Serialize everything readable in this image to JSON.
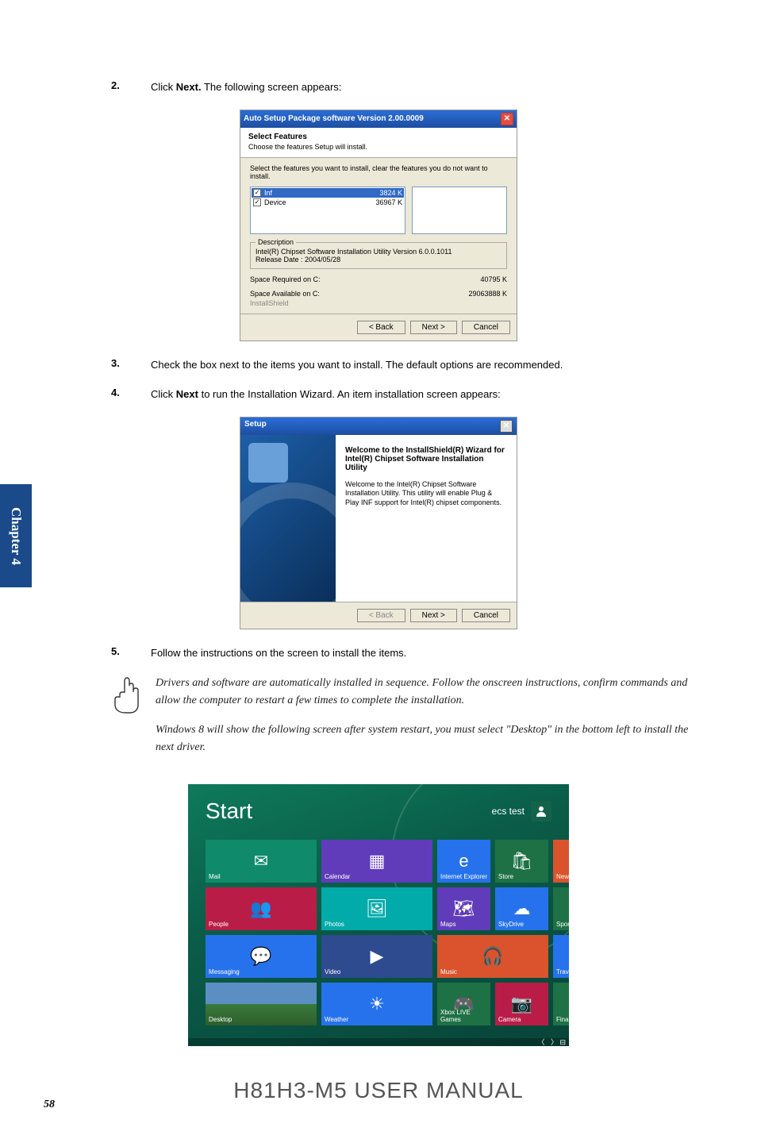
{
  "chapter_tab": "Chapter 4",
  "steps": {
    "s2": {
      "num": "2.",
      "pre": "Click ",
      "bold": "Next.",
      "post": " The following screen appears:"
    },
    "s3": {
      "num": "3.",
      "text": "Check the box next to the items you want to install. The default options are recommended."
    },
    "s4": {
      "num": "4.",
      "pre": "Click ",
      "bold": "Next",
      "post": " to run the Installation Wizard. An item installation screen appears:"
    },
    "s5": {
      "num": "5.",
      "text": "Follow the instructions on the screen to install the items."
    }
  },
  "asp": {
    "title": "Auto Setup Package software Version 2.00.0009",
    "features_title": "Select Features",
    "features_sub": "Choose the features Setup will install.",
    "instruction": "Select the features you want to install, clear the features you do not want to install.",
    "items": [
      {
        "name": "Inf",
        "size": "3824 K",
        "selected": true
      },
      {
        "name": "Device",
        "size": "36967 K",
        "selected": false
      }
    ],
    "desc_legend": "Description",
    "desc_line1": "Intel(R) Chipset Software Installation Utility Version 6.0.0.1011",
    "desc_line2": "Release Date : 2004/05/28",
    "space_req_label": "Space Required on  C:",
    "space_req_val": "40795 K",
    "space_avail_label": "Space Available on  C:",
    "space_avail_val": "29063888 K",
    "brand": "InstallShield",
    "btn_back": "< Back",
    "btn_next": "Next >",
    "btn_cancel": "Cancel"
  },
  "setup": {
    "title": "Setup",
    "heading": "Welcome to the InstallShield(R) Wizard for Intel(R) Chipset Software Installation Utility",
    "para": "Welcome to the Intel(R) Chipset Software Installation Utility. This utility will enable Plug & Play INF support for Intel(R) chipset components.",
    "btn_back": "< Back",
    "btn_next": "Next >",
    "btn_cancel": "Cancel"
  },
  "note": {
    "p1": "Drivers and software are automatically installed in sequence. Follow the onscreen instructions, confirm commands and allow the computer to restart a few times to complete the installation.",
    "p2": "Windows 8 will show the following screen after system restart, you must select \"Desktop\" in the bottom left to install the next driver."
  },
  "win8": {
    "start": "Start",
    "user": "ecs test",
    "tiles": {
      "mail": "Mail",
      "calendar": "Calendar",
      "ie": "Internet Explorer",
      "store": "Store",
      "news": "News",
      "people": "People",
      "photos": "Photos",
      "maps": "Maps",
      "skydrive": "SkyDrive",
      "sports": "Sports",
      "messaging": "Messaging",
      "video": "Video",
      "music": "Music",
      "travel": "Travel",
      "desktop": "Desktop",
      "weather": "Weather",
      "games": "Xbox LIVE Games",
      "camera": "Camera",
      "finance": "Finance"
    }
  },
  "footer": "H81H3-M5 USER MANUAL",
  "page_num": "58"
}
